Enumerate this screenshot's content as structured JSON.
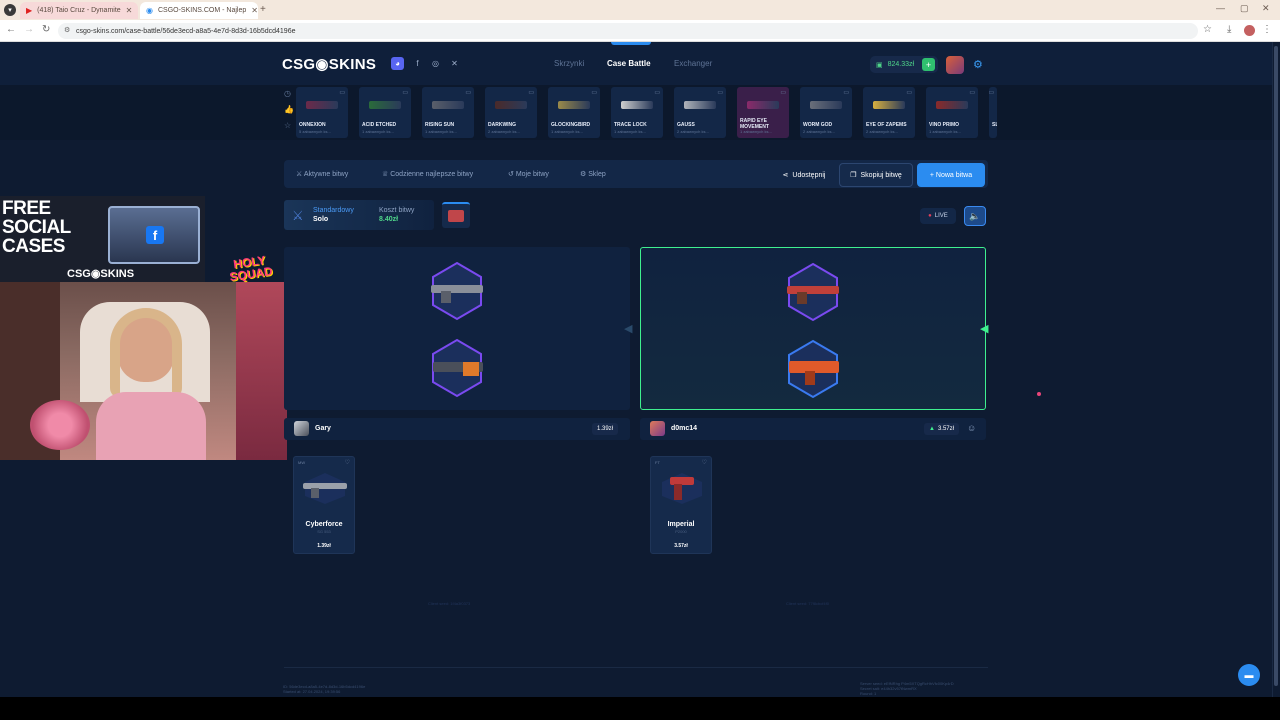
{
  "browser": {
    "tabs": [
      {
        "title": "(418) Taio Cruz - Dynamite",
        "icon": "youtube-icon"
      },
      {
        "title": "CSGO-SKINS.COM - Najlep",
        "icon": "site-icon"
      }
    ],
    "new_tab_symbol": "+",
    "url": "csgo-skins.com/case-battle/56de3ecd-a8a5-4e7d-8d3d-16b5dcd4196e"
  },
  "header": {
    "logo": "CSG◉SKINS",
    "nav": [
      "Skrzynki",
      "Case Battle",
      "Exchanger"
    ],
    "balance": "824.33zł",
    "colors": {
      "accent": "#2b8cf0",
      "success": "#3ff08f"
    }
  },
  "drops": [
    {
      "name": "ONNEXION",
      "sub": "5 zabawnych ks..."
    },
    {
      "name": "ACID ETCHED",
      "sub": "1 zabawnych ks..."
    },
    {
      "name": "RISING SUN",
      "sub": "1 zabawnych ks..."
    },
    {
      "name": "DARKWING",
      "sub": "2 zabawnych ks..."
    },
    {
      "name": "GLOCKINGBIRD",
      "sub": "1 zabawnych ks..."
    },
    {
      "name": "TRACE LOCK",
      "sub": "1 zabawnych ks..."
    },
    {
      "name": "GAUSS",
      "sub": "2 zabawnych ks..."
    },
    {
      "name": "RAPID EYE MOVEMENT",
      "sub": "1 zabawnych ks..."
    },
    {
      "name": "WORM GOD",
      "sub": "2 zabawnych ks..."
    },
    {
      "name": "EYE OF ZAPEMS",
      "sub": "2 zabawnych ks..."
    },
    {
      "name": "VINO PRIMO",
      "sub": "1 zabawnych ks..."
    },
    {
      "name": "SL",
      "sub": ""
    }
  ],
  "stream": {
    "promo_text": "FREE SOCIAL CASES",
    "promo_logo": "CSG◉SKINS",
    "badge": "HOLY SQUAD"
  },
  "menu": {
    "items": [
      "Aktywne bitwy",
      "Codzienne najlepsze bitwy",
      "Moje bitwy",
      "Sklep"
    ],
    "share": "Udostępnij",
    "copy": "Skopiuj bitwę",
    "new": "+ Nowa bitwa"
  },
  "battle": {
    "mode_label": "Standardowy",
    "mode_value": "Solo",
    "cost_label": "Koszt bitwy",
    "cost_value": "8.40zł",
    "live": "LIVE"
  },
  "players": [
    {
      "name": "Gary",
      "total": "1.39zł",
      "win": {
        "quality": "MW",
        "name": "Cyberforce",
        "sub": "SG 553",
        "price": "1.39zł"
      }
    },
    {
      "name": "d0mc14",
      "total": "3.57zł",
      "win": {
        "quality": "FT",
        "name": "Imperial",
        "sub": "P2000",
        "price": "3.57zł"
      }
    }
  ],
  "footer": {
    "left_line1": "ID: 56de3ecd-a8a5-4e7d-8d3d-16b5dcd4196e",
    "left_line2": "Started at: 27.04.2024, 19:39:56",
    "right_line1": "Server seed: eEfNRhg P4m5XTQgRcHhVfc00Kp4rD",
    "right_line2": "Secret salt: e44h32v57tNwmRX",
    "right_line3": "Round: 1",
    "client_left": "Client seed: 1f4a3f0373",
    "client_right": "Client seed: 77f8cbcf4f0"
  }
}
